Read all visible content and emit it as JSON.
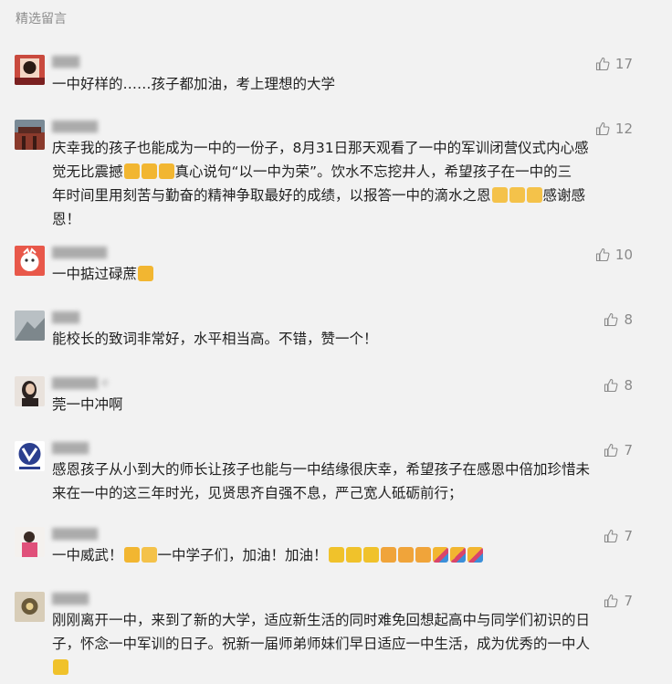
{
  "header": {
    "title": "精选留言"
  },
  "comments": [
    {
      "nick": "▇▇▇",
      "likes": "17",
      "segments": [
        {
          "t": "一中好样的……孩子都加油，考上理想的大学"
        }
      ],
      "avatar_color": "#b23a3a"
    },
    {
      "nick": "▇▇▇▇▇",
      "likes": "12",
      "line1": "庆幸我的孩子也能成为一中的一份子，8月31日那天观看了一中的军训闭营仪式内心感",
      "line2a": "觉无比震撼",
      "line2b": "真心说句“以一中为荣”。饮水不忘挖井人，希望孩子在一中的三",
      "line3": "年时间里用刻苦与勤奋的精神争取最好的成绩，以报答一中的滴水之恩",
      "line3b": "感谢感",
      "line4": "恩！",
      "avatar_color": "#8a3b2f"
    },
    {
      "nick": "▇▇▇▇▇▇",
      "likes": "10",
      "text": "一中掂过碌蔗",
      "avatar_color": "#e8584a"
    },
    {
      "nick": "▇▇▇",
      "likes": "8",
      "text": "能校长的致词非常好，水平相当高。不错，赞一个！",
      "avatar_color": "#9aa3a8"
    },
    {
      "nick": "▇▇▇▇▇ e",
      "likes": "8",
      "text": "莞一中冲啊",
      "avatar_color": "#c9a48a"
    },
    {
      "nick": "▇▇▇▇",
      "likes": "7",
      "line1": "感恩孩子从小到大的师长让孩子也能与一中结缘很庆幸，希望孩子在感恩中倍加珍惜未",
      "line2": "来在一中的这三年时光，见贤思齐自强不息，严己宽人砥砺前行；",
      "avatar_color": "#2b3f8f"
    },
    {
      "nick": "▇▇▇▇▇",
      "likes": "7",
      "text_a": "一中威武！",
      "text_b": "一中学子们，加油！加油！",
      "avatar_color": "#e06a8a"
    },
    {
      "nick": "▇▇▇▇",
      "likes": "7",
      "line1": "刚刚离开一中，来到了新的大学，适应新生活的同时难免回想起高中与同学们初识的日",
      "line2": "子，怀念一中军训的日子。祝新一届师弟师妹们早日适应一中生活，成为优秀的一中人",
      "avatar_color": "#6a5a3a"
    }
  ],
  "icons": {
    "like": "thumbs-up-icon"
  }
}
